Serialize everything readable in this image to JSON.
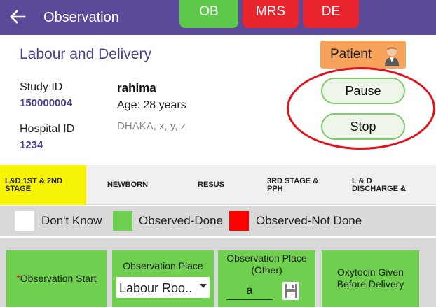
{
  "appbar": {
    "title": "Observation",
    "back_icon": "arrow-left-icon",
    "tags": [
      {
        "label": "OB",
        "color": "#5ec84a"
      },
      {
        "label": "MRS",
        "color": "#e8242c"
      },
      {
        "label": "DE",
        "color": "#e8242c"
      }
    ],
    "color": "#5b4a9a"
  },
  "header": {
    "form_title": "Labour and Delivery",
    "patient_button": {
      "label": "Patient",
      "icon": "person-icon"
    },
    "study_id_label": "Study ID",
    "study_id_value": "150000004",
    "hospital_id_label": "Hospital ID",
    "hospital_id_value": "1234",
    "patient_name": "rahima",
    "patient_age": "Age: 28 years",
    "patient_address": "DHAKA, x, y, z",
    "pause_label": "Pause",
    "stop_label": "Stop"
  },
  "tabs": [
    {
      "label_line1": "L&D 1ST & 2ND",
      "label_line2": "STAGE",
      "active": true
    },
    {
      "label_line1": "NEWBORN",
      "label_line2": "",
      "active": false
    },
    {
      "label_line1": "RESUS",
      "label_line2": "",
      "active": false
    },
    {
      "label_line1": "3RD STAGE &",
      "label_line2": "PPH",
      "active": false
    },
    {
      "label_line1": "L & D",
      "label_line2": "DISCHARGE &",
      "active": false
    }
  ],
  "legend": [
    {
      "label": "Don't Know",
      "color": "#ffffff"
    },
    {
      "label": "Observed-Done",
      "color": "#6fcf4e"
    },
    {
      "label": "Observed-Not Done",
      "color": "#ff0000"
    }
  ],
  "cards": {
    "observation_start": {
      "required_mark": "*",
      "label": "Observation Start"
    },
    "observation_place": {
      "label": "Observation Place",
      "selected": "Labour Roo.."
    },
    "observation_place_other": {
      "label_line1": "Observation Place",
      "label_line2": "(Other)",
      "value": "a",
      "save_icon": "save-icon"
    },
    "oxytocin": {
      "label_line1": "Oxytocin Given",
      "label_line2": "Before Delivery"
    }
  }
}
